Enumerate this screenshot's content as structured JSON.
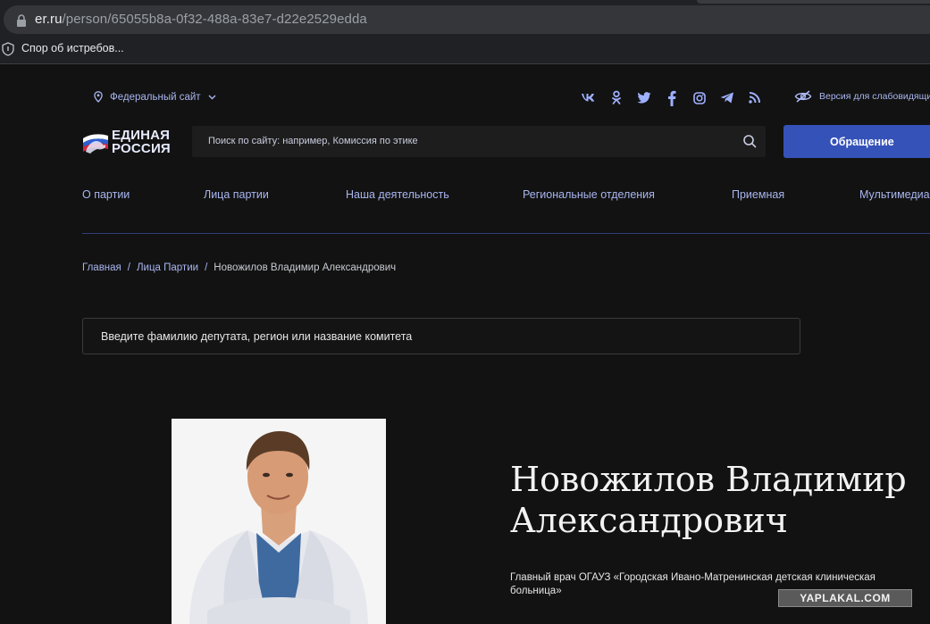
{
  "browser": {
    "url_host": "er.ru",
    "url_path": "/person/65055b8a-0f32-488a-83e7-d22e2529edda",
    "bookmark_label": "Спор об истребов..."
  },
  "header": {
    "region_label": "Федеральный сайт",
    "socials": [
      "vk-icon",
      "odnoklassniki-icon",
      "twitter-icon",
      "facebook-icon",
      "instagram-icon",
      "telegram-icon",
      "rss-icon"
    ],
    "vision_label": "Версия для слабовидящих",
    "logo_line1": "ЕДИНАЯ",
    "logo_line2": "РОССИЯ",
    "search_placeholder": "Поиск по сайту: например, Комиссия по этике",
    "appeal_label": "Обращение"
  },
  "nav": {
    "items": [
      "О партии",
      "Лица партии",
      "Наша деятельность",
      "Региональные отделения",
      "Приемная",
      "Мультимедиа"
    ]
  },
  "breadcrumb": {
    "home": "Главная",
    "section": "Лица Партии",
    "separator": "/",
    "current": "Новожилов Владимир Александрович"
  },
  "deputy_search": {
    "placeholder": "Введите фамилию депутата, регион или название комитета"
  },
  "person": {
    "name_line1": "Новожилов Владимир",
    "name_line2": "Александрович",
    "position": "Главный врач ОГАУЗ «Городская Ивано-Матренинская детская клиническая больница»"
  },
  "watermark": "YAPLAKAL.COM",
  "colors": {
    "background": "#121212",
    "accent_link": "#a9b6f0",
    "button": "#3552b8"
  }
}
